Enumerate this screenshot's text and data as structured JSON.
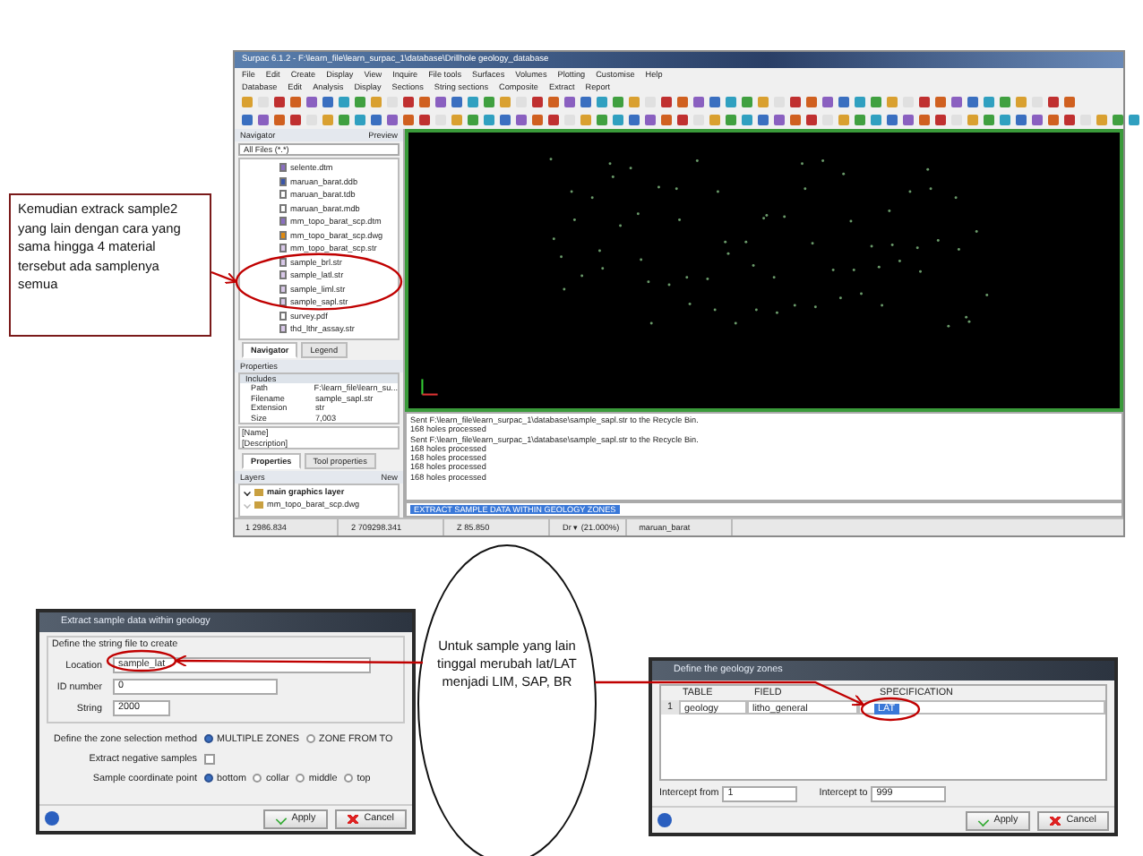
{
  "app_window": {
    "title": "Surpac 6.1.2 - F:\\learn_file\\learn_surpac_1\\database\\Drillhole geology_database",
    "menus": [
      "File",
      "Edit",
      "Create",
      "Display",
      "View",
      "Inquire",
      "File tools",
      "Surfaces",
      "Volumes",
      "Plotting",
      "Customise",
      "Help"
    ],
    "menus_2": [
      "Database",
      "Edit",
      "Analysis",
      "Display",
      "Sections",
      "String sections",
      "Composite",
      "Extract",
      "Report"
    ]
  },
  "navigator": {
    "title": "Navigator",
    "preview": "Preview",
    "filter": "All Files (*.*)",
    "files": [
      {
        "name": "selente.dtm",
        "kind": "dtm"
      },
      {
        "name": "maruan_barat.ddb",
        "kind": "ddb"
      },
      {
        "name": "maruan_barat.tdb",
        "kind": "tdb"
      },
      {
        "name": "maruan_barat.mdb",
        "kind": "mdb"
      },
      {
        "name": "mm_topo_barat_scp.dtm",
        "kind": "dtm"
      },
      {
        "name": "mm_topo_barat_scp.dwg",
        "kind": "dwg"
      },
      {
        "name": "mm_topo_barat_scp.str",
        "kind": "str"
      },
      {
        "name": "sample_brl.str",
        "kind": "str"
      },
      {
        "name": "sample_latl.str",
        "kind": "str"
      },
      {
        "name": "sample_liml.str",
        "kind": "str"
      },
      {
        "name": "sample_sapl.str",
        "kind": "str"
      },
      {
        "name": "survey.pdf",
        "kind": "pdf"
      },
      {
        "name": "thd_lthr_assay.str",
        "kind": "str"
      }
    ],
    "tabs": [
      {
        "label": "Navigator",
        "selected": true
      },
      {
        "label": "Legend",
        "selected": false
      }
    ]
  },
  "properties": {
    "title": "Properties",
    "group": "Includes",
    "rows": [
      {
        "label": "Path",
        "value": "F:\\learn_file\\learn_su..."
      },
      {
        "label": "Filename",
        "value": "sample_sapl.str"
      },
      {
        "label": "Extension",
        "value": "str"
      },
      {
        "label": "Size",
        "value": "7,003"
      }
    ],
    "name_label": "[Name]",
    "description_label": "[Description]",
    "tabs": [
      {
        "label": "Properties",
        "selected": true
      },
      {
        "label": "Tool properties",
        "selected": false
      }
    ]
  },
  "layers": {
    "title": "Layers",
    "new": "New",
    "items": [
      {
        "name": "main graphics layer",
        "selected": true,
        "visible": true
      },
      {
        "name": "mm_topo_barat_scp.dwg",
        "selected": false,
        "visible": false
      }
    ]
  },
  "log": {
    "lines": [
      "Sent F:\\learn_file\\learn_surpac_1\\database\\sample_sapl.str to the Recycle Bin.",
      "168 holes processed",
      "Sent F:\\learn_file\\learn_surpac_1\\database\\sample_sapl.str to the Recycle Bin.",
      "168 holes processed",
      "168 holes processed",
      "168 holes processed",
      "168 holes processed"
    ],
    "command": "EXTRACT SAMPLE DATA WITHIN GEOLOGY ZONES"
  },
  "status_bar": {
    "fields": [
      "1  2986.834",
      "2  709298.341",
      "Z  85.850"
    ],
    "zoom": "Dr ▾ (21.000%)",
    "layer": "maruan_barat"
  },
  "callout_box": {
    "text": "Kemudian extrack sample2 yang lain dengan cara yang sama hingga 4 material tersebut ada samplenya semua"
  },
  "callout_ellipse": {
    "text": "Untuk sample yang lain tinggal merubah lat/LAT menjadi LIM, SAP, BR"
  },
  "extract_dialog": {
    "title": "Extract sample data within geology",
    "group_title": "Define the string file to create",
    "location_label": "Location",
    "location": "sample_lat",
    "id_label": "ID number",
    "id": "0",
    "string_label": "String",
    "string": "2000",
    "zone_method_label": "Define the zone selection method",
    "zone_methods": [
      {
        "label": "MULTIPLE ZONES",
        "selected": true
      },
      {
        "label": "ZONE FROM TO",
        "selected": false
      }
    ],
    "negative_label": "Extract negative samples",
    "negative_checked": false,
    "coordinate_label": "Sample coordinate point",
    "coordinate_points": [
      {
        "label": "bottom",
        "selected": true
      },
      {
        "label": "collar",
        "selected": false
      },
      {
        "label": "middle",
        "selected": false
      },
      {
        "label": "top",
        "selected": false
      }
    ],
    "buttons": [
      {
        "label": "Apply",
        "kind": "apply"
      },
      {
        "label": "Cancel",
        "kind": "cancel"
      }
    ]
  },
  "zones_dialog": {
    "title": "Define the geology zones",
    "columns": [
      "TABLE",
      "FIELD",
      "SPECIFICATION"
    ],
    "rows": [
      {
        "index": "1",
        "table": "geology",
        "field": "litho_general",
        "specification": "LAT"
      }
    ],
    "from_label": "Intercept from",
    "from": "1",
    "to_label": "Intercept to",
    "to": "999",
    "buttons": [
      {
        "label": "Apply",
        "kind": "apply"
      },
      {
        "label": "Cancel",
        "kind": "cancel"
      }
    ]
  }
}
